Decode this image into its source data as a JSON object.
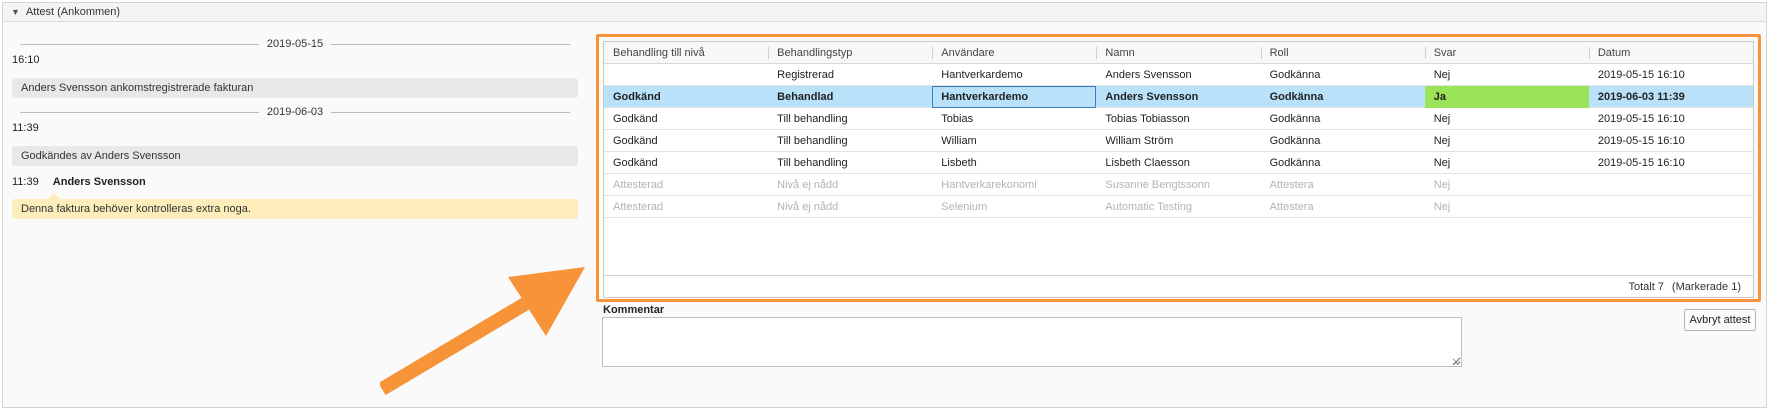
{
  "panel": {
    "title": "Attest (Ankommen)"
  },
  "timeline": {
    "date1": "2019-05-15",
    "time1": "16:10",
    "msg1": "Anders Svensson ankomstregistrerade fakturan",
    "date2": "2019-06-03",
    "time2": "11:39",
    "msg2": "Godkändes av Anders Svensson",
    "comment_time": "11:39",
    "comment_user": "Anders Svensson",
    "comment_text": "Denna faktura behöver kontrolleras extra noga."
  },
  "grid": {
    "columns": [
      "Behandling till nivå",
      "Behandlingstyp",
      "Användare",
      "Namn",
      "Roll",
      "Svar",
      "Datum"
    ],
    "rows": [
      [
        "",
        "Registrerad",
        "Hantverkardemo",
        "Anders Svensson",
        "Godkänna",
        "Nej",
        "2019-05-15 16:10"
      ],
      [
        "Godkänd",
        "Behandlad",
        "Hantverkardemo",
        "Anders Svensson",
        "Godkänna",
        "Ja",
        "2019-06-03 11:39"
      ],
      [
        "Godkänd",
        "Till behandling",
        "Tobias",
        "Tobias Tobiasson",
        "Godkänna",
        "Nej",
        "2019-05-15 16:10"
      ],
      [
        "Godkänd",
        "Till behandling",
        "William",
        "William Ström",
        "Godkänna",
        "Nej",
        "2019-05-15 16:10"
      ],
      [
        "Godkänd",
        "Till behandling",
        "Lisbeth",
        "Lisbeth Claesson",
        "Godkänna",
        "Nej",
        "2019-05-15 16:10"
      ],
      [
        "Attesterad",
        "Nivå ej nådd",
        "Hantverkarekonomi",
        "Susanne Bengtssonn",
        "Attestera",
        "Nej",
        ""
      ],
      [
        "Attesterad",
        "Nivå ej nådd",
        "Selenium",
        "Automatic Testing",
        "Attestera",
        "Nej",
        ""
      ]
    ],
    "total": "Totalt 7",
    "selected": "(Markerade 1)"
  },
  "comment": {
    "label": "Kommentar",
    "value": ""
  },
  "actions": {
    "cancel_label": "Avbryt attest"
  },
  "colors": {
    "highlight": "#f7943a",
    "selected_row": "#b9e2fa",
    "answer_yes": "#9be358",
    "note_bg": "#fdedbb"
  }
}
